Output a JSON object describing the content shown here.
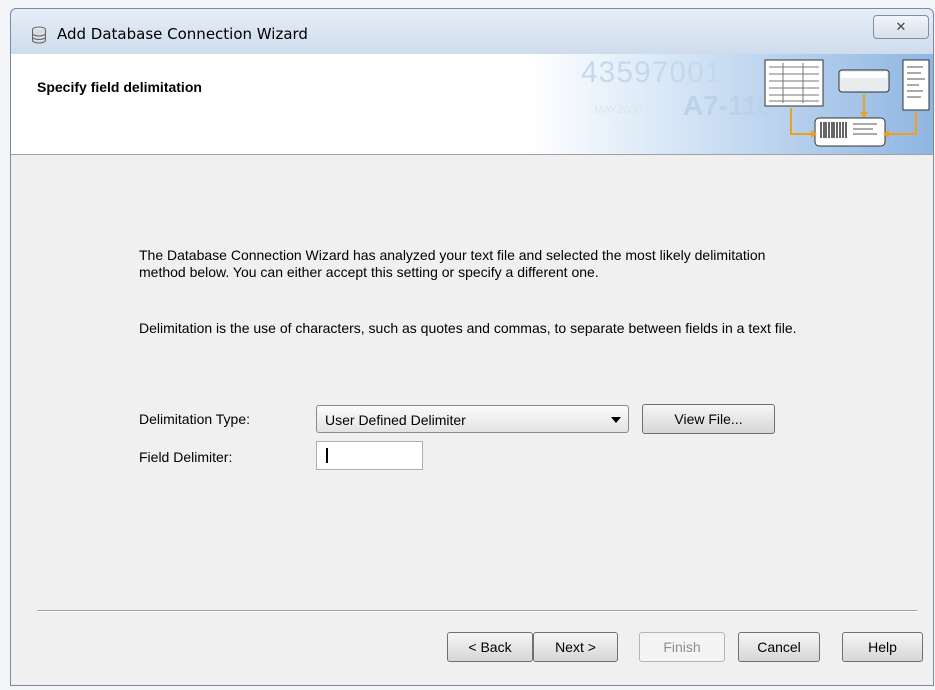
{
  "window": {
    "title": "Add Database Connection Wizard",
    "close_glyph": "✕"
  },
  "header": {
    "title": "Specify field delimitation",
    "banner_numbers_1": "43597001",
    "banner_numbers_2": "A7-118",
    "banner_numbers_3": "MAY2000"
  },
  "body": {
    "paragraph_1": "The Database Connection Wizard has analyzed your text file and selected the most likely delimitation method below.  You can either accept this setting or specify a different one.",
    "paragraph_2": "Delimitation is the use of characters, such as quotes and commas, to separate between fields in a text file."
  },
  "form": {
    "delimitation_type_label": "Delimitation Type:",
    "delimitation_type_value": "User Defined Delimiter",
    "view_file_button": "View File...",
    "field_delimiter_label": "Field Delimiter:",
    "field_delimiter_value": ""
  },
  "footer": {
    "back": "< Back",
    "next": "Next >",
    "finish": "Finish",
    "cancel": "Cancel",
    "help": "Help"
  },
  "icons": {
    "title_icon": "database-icon",
    "banner_icon": "database-wizard-banner-icon",
    "dropdown_icon": "chevron-down-icon",
    "close_icon": "close-icon"
  }
}
